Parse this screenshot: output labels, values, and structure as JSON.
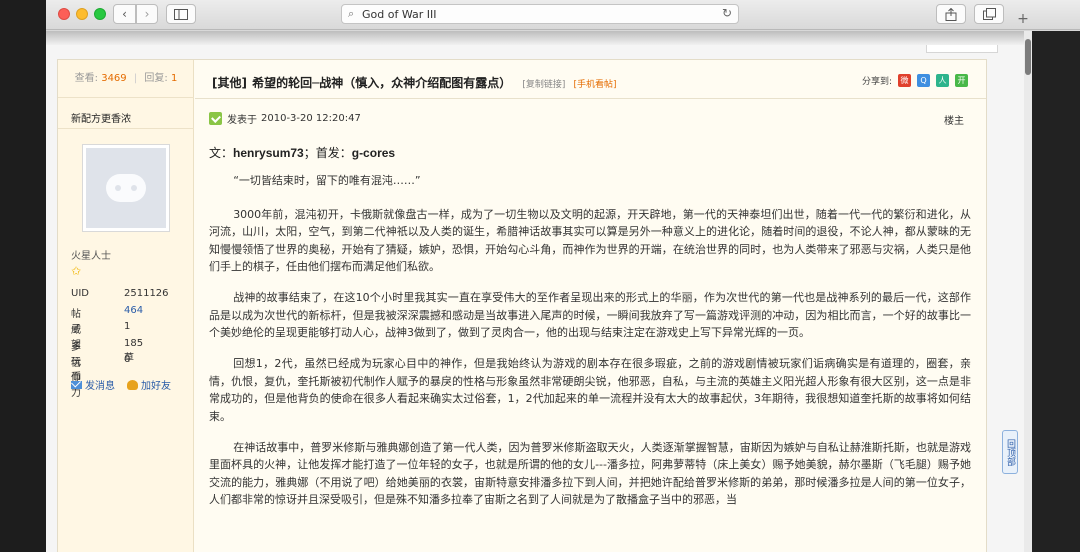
{
  "browser": {
    "address_text": "God of War III",
    "search_glyph": "⌕",
    "reload_glyph": "↻",
    "back_glyph": "‹",
    "forward_glyph": "›",
    "newtab_glyph": "+"
  },
  "thread": {
    "views_label": "查看:",
    "views": "3469",
    "replies_label": "回复:",
    "replies": "1",
    "category": "[其他]",
    "title": "希望的轮回─战神（慎入，众神介绍配图有露点）",
    "copy_link": "[复制链接]",
    "mobile_link": "[手机看帖]",
    "share_label": "分享到:"
  },
  "user": {
    "name": "新配方更香浓",
    "group": "火星人士",
    "profile": [
      {
        "key": "UID",
        "value": "2511126"
      },
      {
        "key": "帖子",
        "value": "464"
      },
      {
        "key": "威望",
        "value": "1"
      },
      {
        "key": "多玩币",
        "value": "185 草"
      },
      {
        "key": "信仰力",
        "value": "0"
      }
    ],
    "send_message": "发消息",
    "add_friend": "加好友"
  },
  "post": {
    "posted_prefix": "发表于",
    "posted_time": "2010-3-20 12:20:47",
    "floor": "楼主",
    "byline_prefix": "文：",
    "author": "henrysum73",
    "byline_mid": "；首发：",
    "source": "g-cores",
    "paragraphs": [
      "“一切皆结束时，留下的唯有混沌……”",
      "3000年前，混沌初开，卡俄斯就像盘古一样，成为了一切生物以及文明的起源，开天辟地，第一代的天神泰坦们出世，随着一代一代的繁衍和进化，从河流，山川，太阳，空气，到第二代神祇以及人类的诞生，希腊神话故事其实可以算是另外一种意义上的进化论，随着时间的退役，不论人神，都从蒙昧的无知慢慢领悟了世界的奥秘，开始有了猜疑，嫉妒，恐惧，开始勾心斗角，而神作为世界的开端，在统治世界的同时，也为人类带来了邪恶与灾祸，人类只是他们手上的棋子，任由他们摆布而满足他们私欲。",
      "战神的故事结束了，在这10个小时里我其实一直在享受伟大的至作者呈现出来的形式上的华丽，作为次世代的第一代也是战神系列的最后一代，这部作品是以成为次世代的新标杆，但是我被深深震撼和感动是当故事进入尾声的时候，一瞬间我放弃了写一篇游戏评测的冲动，因为相比而言，一个好的故事比一个美妙绝伦的呈现更能够打动人心，战神3做到了，做到了灵肉合一，他的出现与结束注定在游戏史上写下异常光辉的一页。",
      "回想1，2代，虽然已经成为玩家心目中的神作，但是我始终认为游戏的剧本存在很多瑕疵，之前的游戏剧情被玩家们诟病确实是有道理的，圈套，亲情，仇恨，复仇，奎托斯被初代制作人赋予的暴戾的性格与形象虽然非常硬朗尖锐，他邪恶，自私，与主流的英雄主义阳光超人形象有很大区别，这一点是非常成功的，但是他背负的使命在很多人看起来确实太过俗套，1，2代加起来的单一流程并没有太大的故事起伏，3年期待，我很想知道奎托斯的故事将如何结束。",
      "在神话故事中，普罗米修斯与雅典娜创造了第一代人类，因为普罗米修斯盗取天火，人类逐渐掌握智慧，宙斯因为嫉妒与自私让赫淮斯托斯，也就是游戏里面杯具的火神，让他发挥才能打造了一位年轻的女子，也就是所谓的他的女儿---潘多拉，阿弗萝蒂特（床上美女）赐予她美貌，赫尔墨斯（飞毛腿）赐予她交流的能力，雅典娜（不用说了吧）给她美丽的衣裳，宙斯特意安排潘多拉下到人间，并把她许配给普罗米修斯的弟弟，那时候潘多拉是人间的第一位女子，人们都非常的惊讶并且深受吸引，但是殊不知潘多拉奉了宙斯之名到了人间就是为了散播盒子当中的邪恶，当"
    ]
  },
  "side_tab": "回顶部"
}
